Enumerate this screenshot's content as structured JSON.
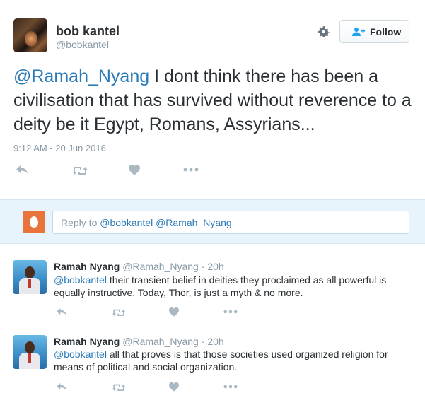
{
  "main_tweet": {
    "author_name": "bob kantel",
    "author_handle": "@bobkantel",
    "follow_label": "Follow",
    "mention": "@Ramah_Nyang",
    "text": " I dont think there has been a civilisation that has survived without reverence to a deity be it Egypt, Romans, Assyrians...",
    "timestamp": "9:12 AM - 20 Jun 2016"
  },
  "reply_box": {
    "prefix": "Reply to ",
    "mentions": "@bobkantel @Ramah_Nyang"
  },
  "replies": [
    {
      "name": "Ramah Nyang",
      "handle": "@Ramah_Nyang",
      "time": "20h",
      "mention": "@bobkantel",
      "text": " their transient belief in deities they proclaimed as all powerful is equally instructive. Today, Thor, is just a myth & no more."
    },
    {
      "name": "Ramah Nyang",
      "handle": "@Ramah_Nyang",
      "time": "20h",
      "mention": "@bobkantel",
      "text": " all that proves is that those societies used organized religion for means of political and social organization."
    }
  ],
  "colors": {
    "link": "#2b7bb9",
    "muted": "#8899a6",
    "icon": "#aab8c2",
    "reply_bg": "#e8f4fb",
    "egg": "#e8743b"
  },
  "icons": [
    "gear-icon",
    "follow-person-icon",
    "reply-icon",
    "retweet-icon",
    "like-icon",
    "more-icon",
    "egg-avatar-icon"
  ]
}
